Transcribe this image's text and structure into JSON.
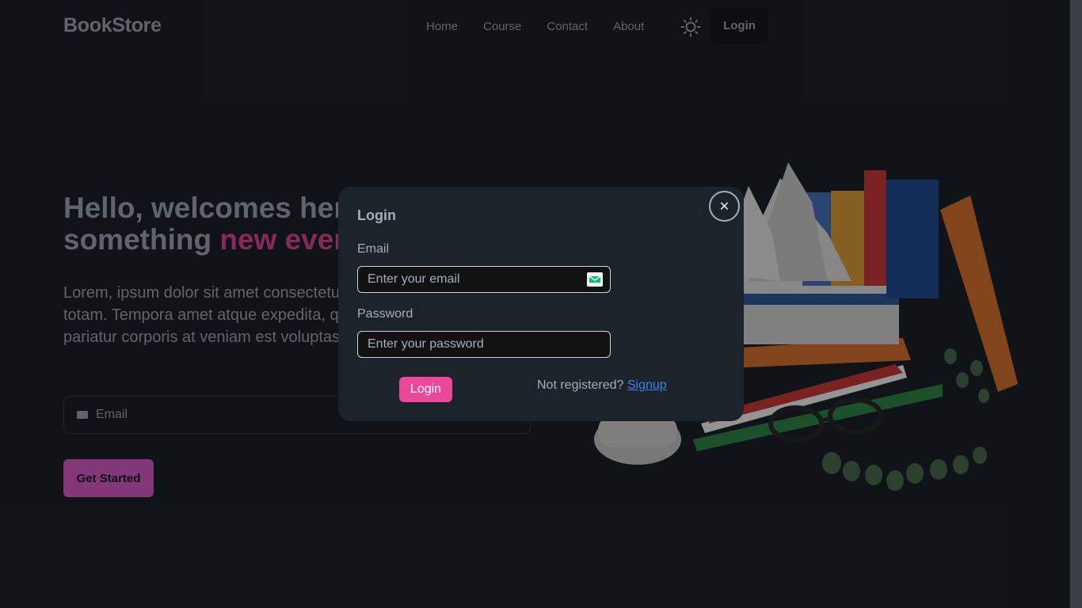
{
  "header": {
    "brand": "BookStore",
    "nav": [
      "Home",
      "Course",
      "Contact",
      "About"
    ],
    "theme_icon": "sun-icon",
    "login_label": "Login"
  },
  "hero": {
    "title_line1": "Hello, welcomes here to learn",
    "title_line2_prefix": "something ",
    "title_line2_accent": "new everyday!!!",
    "description": "Lorem, ipsum dolor sit amet consectetur adipisicing elit. Dolor, et totam. Tempora amet atque expedita, quae corrupti totam sed pariatur corporis at veniam est voluptas animi!",
    "email_placeholder": "Email",
    "cta_label": "Get Started"
  },
  "modal": {
    "title": "Login",
    "close_label": "✕",
    "email_label": "Email",
    "email_placeholder": "Enter your email",
    "password_label": "Password",
    "password_placeholder": "Enter your password",
    "submit_label": "Login",
    "not_registered": "Not registered? ",
    "signup_label": "Signup"
  },
  "colors": {
    "background": "#1d232a",
    "accent": "#ec4899",
    "cta": "#e25fd0",
    "link": "#3b82f6"
  }
}
